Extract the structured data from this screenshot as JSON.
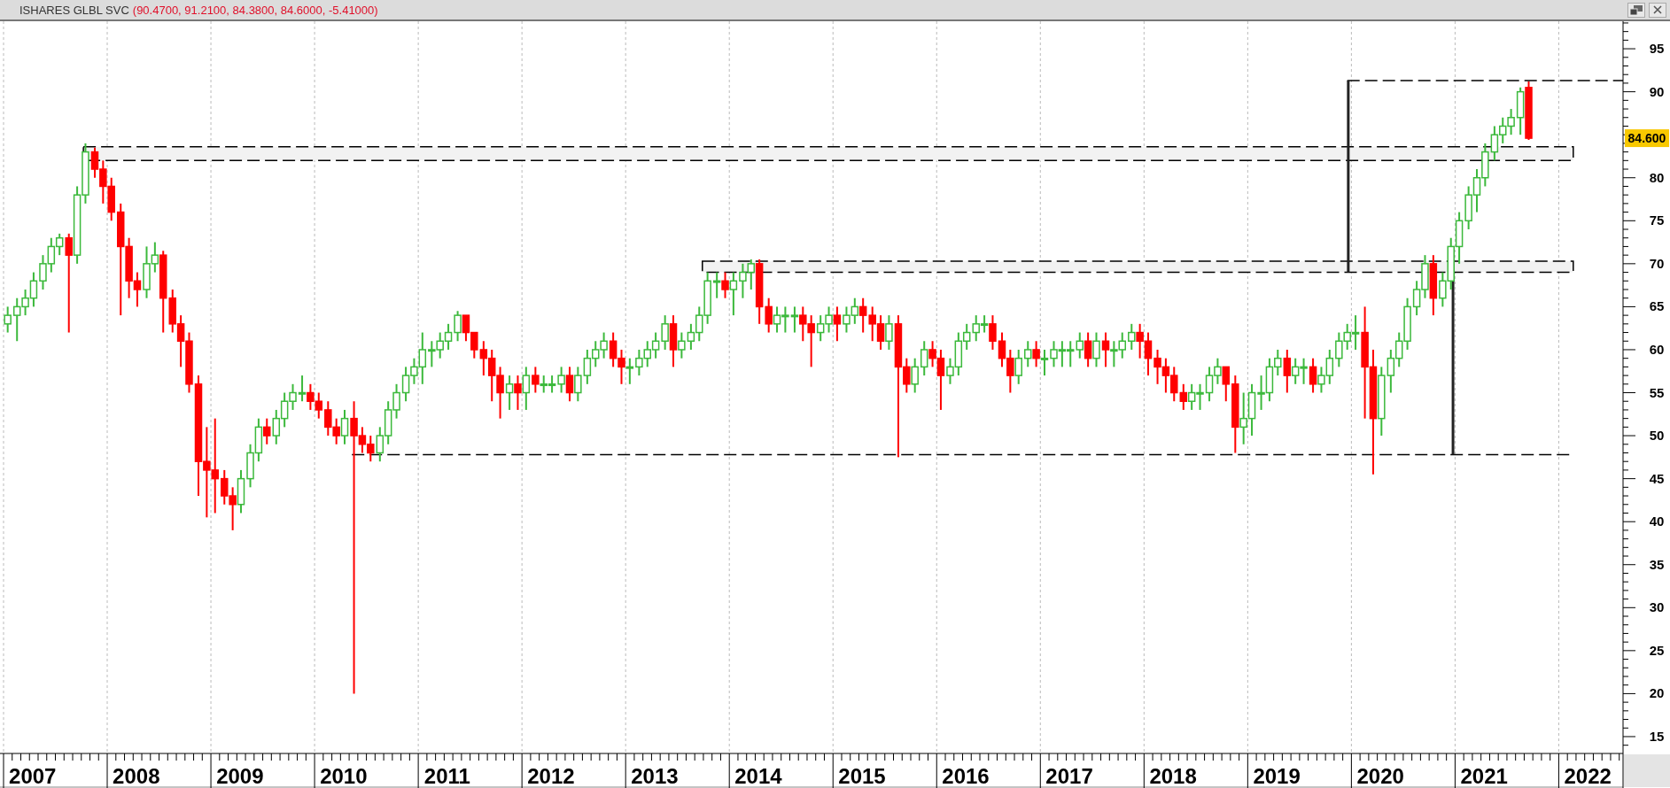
{
  "window": {
    "title": "ISHARES GLBL SVC",
    "title_values": "(90.4700, 91.2100, 84.3800, 84.6000, -5.41000)"
  },
  "chart_data": {
    "type": "candlestick",
    "xlim": [
      2007,
      2022.62
    ],
    "ylim": [
      13.04,
      98.2
    ],
    "xticks": [
      {
        "value": 2007.28,
        "label": "2007"
      },
      {
        "value": 2008.28,
        "label": "2008"
      },
      {
        "value": 2009.28,
        "label": "2009"
      },
      {
        "value": 2010.28,
        "label": "2010"
      },
      {
        "value": 2011.28,
        "label": "2011"
      },
      {
        "value": 2012.28,
        "label": "2012"
      },
      {
        "value": 2013.28,
        "label": "2013"
      },
      {
        "value": 2014.28,
        "label": "2014"
      },
      {
        "value": 2015.28,
        "label": "2015"
      },
      {
        "value": 2016.28,
        "label": "2016"
      },
      {
        "value": 2017.28,
        "label": "2017"
      },
      {
        "value": 2018.28,
        "label": "2018"
      },
      {
        "value": 2019.28,
        "label": "2019"
      },
      {
        "value": 2020.28,
        "label": "2020"
      },
      {
        "value": 2021.28,
        "label": "2021"
      },
      {
        "value": 2022.28,
        "label": "2022"
      }
    ],
    "yticks": [
      {
        "value": 15,
        "label": "15"
      },
      {
        "value": 20,
        "label": "20"
      },
      {
        "value": 25,
        "label": "25"
      },
      {
        "value": 30,
        "label": "30"
      },
      {
        "value": 35,
        "label": "35"
      },
      {
        "value": 40,
        "label": "40"
      },
      {
        "value": 45,
        "label": "45"
      },
      {
        "value": 50,
        "label": "50"
      },
      {
        "value": 55,
        "label": "55"
      },
      {
        "value": 60,
        "label": "60"
      },
      {
        "value": 65,
        "label": "65"
      },
      {
        "value": 70,
        "label": "70"
      },
      {
        "value": 75,
        "label": "75"
      },
      {
        "value": 80,
        "label": "80"
      },
      {
        "value": 90,
        "label": "90"
      },
      {
        "value": 95,
        "label": "95"
      }
    ],
    "x": [
      2007.04,
      2007.13,
      2007.21,
      2007.29,
      2007.38,
      2007.46,
      2007.54,
      2007.63,
      2007.71,
      2007.79,
      2007.88,
      2007.96,
      2008.04,
      2008.13,
      2008.21,
      2008.29,
      2008.38,
      2008.46,
      2008.54,
      2008.63,
      2008.71,
      2008.79,
      2008.88,
      2008.96,
      2009.04,
      2009.13,
      2009.21,
      2009.29,
      2009.38,
      2009.46,
      2009.54,
      2009.63,
      2009.71,
      2009.79,
      2009.88,
      2009.96,
      2010.04,
      2010.13,
      2010.21,
      2010.29,
      2010.38,
      2010.46,
      2010.54,
      2010.63,
      2010.71,
      2010.79,
      2010.88,
      2010.96,
      2011.04,
      2011.13,
      2011.21,
      2011.29,
      2011.38,
      2011.46,
      2011.54,
      2011.63,
      2011.71,
      2011.79,
      2011.88,
      2011.96,
      2012.04,
      2012.13,
      2012.21,
      2012.29,
      2012.38,
      2012.46,
      2012.54,
      2012.63,
      2012.71,
      2012.79,
      2012.88,
      2012.96,
      2013.04,
      2013.13,
      2013.21,
      2013.29,
      2013.38,
      2013.46,
      2013.54,
      2013.63,
      2013.71,
      2013.79,
      2013.88,
      2013.96,
      2014.04,
      2014.13,
      2014.21,
      2014.29,
      2014.38,
      2014.46,
      2014.54,
      2014.63,
      2014.71,
      2014.79,
      2014.88,
      2014.96,
      2015.04,
      2015.13,
      2015.21,
      2015.29,
      2015.38,
      2015.46,
      2015.54,
      2015.63,
      2015.71,
      2015.79,
      2015.88,
      2015.96,
      2016.04,
      2016.13,
      2016.21,
      2016.29,
      2016.38,
      2016.46,
      2016.54,
      2016.63,
      2016.71,
      2016.79,
      2016.88,
      2016.96,
      2017.04,
      2017.13,
      2017.21,
      2017.29,
      2017.38,
      2017.46,
      2017.54,
      2017.63,
      2017.71,
      2017.79,
      2017.88,
      2017.96,
      2018.04,
      2018.13,
      2018.21,
      2018.29,
      2018.38,
      2018.46,
      2018.54,
      2018.63,
      2018.71,
      2018.79,
      2018.88,
      2018.96,
      2019.04,
      2019.13,
      2019.21,
      2019.29,
      2019.38,
      2019.46,
      2019.54,
      2019.63,
      2019.71,
      2019.79,
      2019.88,
      2019.96,
      2020.04,
      2020.13,
      2020.21,
      2020.29,
      2020.38,
      2020.46,
      2020.54,
      2020.63,
      2020.71,
      2020.79,
      2020.88,
      2020.96,
      2021.04,
      2021.13,
      2021.21,
      2021.29,
      2021.38,
      2021.46,
      2021.54,
      2021.63,
      2021.71
    ],
    "ohlc": [
      [
        63,
        65,
        62,
        64
      ],
      [
        64,
        66,
        61,
        65
      ],
      [
        65,
        67,
        64,
        66
      ],
      [
        66,
        69,
        65,
        68
      ],
      [
        68,
        71,
        67,
        70
      ],
      [
        70,
        73,
        69,
        72
      ],
      [
        72,
        73.5,
        71,
        73
      ],
      [
        73,
        73.5,
        62,
        71
      ],
      [
        71,
        79,
        70,
        78
      ],
      [
        78,
        84,
        77,
        83
      ],
      [
        83,
        83.5,
        80,
        81
      ],
      [
        81,
        82,
        77,
        79
      ],
      [
        79,
        80,
        75,
        76
      ],
      [
        76,
        77,
        64,
        72
      ],
      [
        72,
        73,
        66,
        68
      ],
      [
        68,
        69,
        65,
        67
      ],
      [
        67,
        72,
        66,
        70
      ],
      [
        70,
        72.5,
        69,
        71
      ],
      [
        71,
        71.5,
        62,
        66
      ],
      [
        66,
        67,
        62,
        63
      ],
      [
        63,
        64,
        58,
        61
      ],
      [
        61,
        62,
        55,
        56
      ],
      [
        56,
        57,
        43,
        47
      ],
      [
        47,
        51,
        40.5,
        46
      ],
      [
        46,
        52,
        41,
        45
      ],
      [
        45,
        46,
        42,
        43
      ],
      [
        43,
        44,
        39,
        42
      ],
      [
        42,
        46,
        41,
        45
      ],
      [
        45,
        49,
        44,
        48
      ],
      [
        48,
        52,
        47,
        51
      ],
      [
        51,
        52,
        49,
        50
      ],
      [
        50,
        53,
        49,
        52
      ],
      [
        52,
        55,
        51,
        54
      ],
      [
        54,
        56,
        53,
        55
      ],
      [
        55,
        57,
        54,
        55
      ],
      [
        55,
        56,
        53,
        54
      ],
      [
        54,
        55,
        52,
        53
      ],
      [
        53,
        54,
        50,
        51
      ],
      [
        51,
        52,
        49,
        50
      ],
      [
        50,
        53,
        49,
        52
      ],
      [
        52,
        54,
        20,
        50
      ],
      [
        50,
        51,
        48,
        49
      ],
      [
        49,
        50,
        47,
        48
      ],
      [
        48,
        51,
        47,
        50
      ],
      [
        50,
        54,
        49,
        53
      ],
      [
        53,
        56,
        52,
        55
      ],
      [
        55,
        58,
        54,
        57
      ],
      [
        57,
        59,
        56,
        58
      ],
      [
        58,
        62,
        56,
        60
      ],
      [
        60,
        61,
        58,
        60
      ],
      [
        60,
        62,
        59,
        61
      ],
      [
        61,
        63,
        60,
        62
      ],
      [
        62,
        64.5,
        61,
        64
      ],
      [
        64,
        64,
        61,
        62
      ],
      [
        62,
        62,
        59,
        60
      ],
      [
        60,
        61,
        57,
        59
      ],
      [
        59,
        60,
        54,
        57
      ],
      [
        57,
        58,
        52,
        55
      ],
      [
        55,
        57,
        53,
        56
      ],
      [
        56,
        57,
        53,
        55
      ],
      [
        55,
        58,
        53,
        57
      ],
      [
        57,
        58,
        55,
        56
      ],
      [
        56,
        57,
        55,
        56
      ],
      [
        56,
        57,
        55,
        56
      ],
      [
        56,
        58,
        55,
        57
      ],
      [
        57,
        58,
        54,
        55
      ],
      [
        55,
        58,
        54,
        57
      ],
      [
        57,
        60,
        56,
        59
      ],
      [
        59,
        61,
        58,
        60
      ],
      [
        60,
        62,
        59,
        61
      ],
      [
        61,
        62,
        58,
        59
      ],
      [
        59,
        60,
        56,
        58
      ],
      [
        58,
        59,
        56,
        58
      ],
      [
        58,
        60,
        57,
        59
      ],
      [
        59,
        61,
        58,
        60
      ],
      [
        60,
        62,
        59,
        61
      ],
      [
        61,
        64,
        60,
        63
      ],
      [
        63,
        64,
        58,
        60
      ],
      [
        60,
        62,
        59,
        61
      ],
      [
        61,
        63,
        60,
        62
      ],
      [
        62,
        65,
        61,
        64
      ],
      [
        64,
        69,
        63,
        68
      ],
      [
        68,
        69,
        66,
        68
      ],
      [
        68,
        69,
        66,
        67
      ],
      [
        67,
        69,
        64,
        68
      ],
      [
        68,
        70,
        66,
        69
      ],
      [
        69,
        70.5,
        67,
        70
      ],
      [
        70,
        70.5,
        63,
        65
      ],
      [
        65,
        66,
        62,
        63
      ],
      [
        63,
        65,
        62,
        64
      ],
      [
        64,
        65,
        62,
        64
      ],
      [
        64,
        65,
        62,
        64
      ],
      [
        64,
        65,
        61,
        63
      ],
      [
        63,
        64,
        58,
        62
      ],
      [
        62,
        64,
        61,
        63
      ],
      [
        63,
        65,
        62,
        64
      ],
      [
        64,
        65,
        61,
        63
      ],
      [
        63,
        65,
        62,
        64
      ],
      [
        64,
        66,
        63,
        65
      ],
      [
        65,
        66,
        62,
        64
      ],
      [
        64,
        65,
        61,
        63
      ],
      [
        63,
        64,
        60,
        61
      ],
      [
        61,
        64,
        60,
        63
      ],
      [
        63,
        64,
        47.5,
        58
      ],
      [
        58,
        59,
        55,
        56
      ],
      [
        56,
        59,
        55,
        58
      ],
      [
        58,
        61,
        57,
        60
      ],
      [
        60,
        61,
        58,
        59
      ],
      [
        59,
        60,
        53,
        57
      ],
      [
        57,
        59,
        56,
        58
      ],
      [
        58,
        62,
        57,
        61
      ],
      [
        61,
        63,
        60,
        62
      ],
      [
        62,
        64,
        61,
        63
      ],
      [
        63,
        64,
        62,
        63
      ],
      [
        63,
        64,
        60,
        61
      ],
      [
        61,
        62,
        58,
        59
      ],
      [
        59,
        60,
        55,
        57
      ],
      [
        57,
        60,
        56,
        59
      ],
      [
        59,
        61,
        58,
        60
      ],
      [
        60,
        61,
        58,
        59
      ],
      [
        59,
        60,
        57,
        59
      ],
      [
        59,
        61,
        58,
        60
      ],
      [
        60,
        61,
        58,
        60
      ],
      [
        60,
        61,
        58,
        60
      ],
      [
        60,
        62,
        59,
        61
      ],
      [
        61,
        62,
        58,
        59
      ],
      [
        59,
        62,
        58,
        61
      ],
      [
        61,
        62,
        58,
        60
      ],
      [
        60,
        61,
        58,
        60
      ],
      [
        60,
        62,
        59,
        61
      ],
      [
        61,
        63,
        60,
        62
      ],
      [
        62,
        63,
        59,
        61
      ],
      [
        61,
        62,
        57,
        59
      ],
      [
        59,
        60,
        56,
        58
      ],
      [
        58,
        59,
        55,
        57
      ],
      [
        57,
        58,
        54,
        55
      ],
      [
        55,
        56,
        53,
        54
      ],
      [
        54,
        56,
        53,
        55
      ],
      [
        55,
        56,
        53,
        55
      ],
      [
        55,
        58,
        54,
        57
      ],
      [
        57,
        59,
        56,
        58
      ],
      [
        58,
        58,
        54,
        56
      ],
      [
        56,
        57,
        48,
        51
      ],
      [
        51,
        55,
        49,
        52
      ],
      [
        52,
        56,
        50,
        55
      ],
      [
        55,
        57,
        53,
        55
      ],
      [
        55,
        59,
        54,
        58
      ],
      [
        58,
        60,
        57,
        59
      ],
      [
        59,
        60,
        55,
        57
      ],
      [
        57,
        59,
        56,
        58
      ],
      [
        58,
        59,
        56,
        58
      ],
      [
        58,
        59,
        55,
        56
      ],
      [
        56,
        58,
        55,
        57
      ],
      [
        57,
        60,
        56,
        59
      ],
      [
        59,
        62,
        58,
        61
      ],
      [
        61,
        63,
        60,
        62
      ],
      [
        62,
        64,
        60,
        62
      ],
      [
        62,
        65,
        52,
        58
      ],
      [
        58,
        60,
        45.5,
        52
      ],
      [
        52,
        58,
        50,
        57
      ],
      [
        57,
        60,
        55,
        59
      ],
      [
        59,
        62,
        58,
        61
      ],
      [
        61,
        66,
        60,
        65
      ],
      [
        65,
        68,
        64,
        67
      ],
      [
        67,
        71,
        66,
        70
      ],
      [
        70,
        71,
        64,
        66
      ],
      [
        66,
        69,
        65,
        68
      ],
      [
        68,
        73,
        67,
        72
      ],
      [
        72,
        76,
        70,
        75
      ],
      [
        75,
        79,
        74,
        78
      ],
      [
        78,
        81,
        76,
        80
      ],
      [
        80,
        84,
        79,
        83
      ],
      [
        83,
        86,
        82,
        85
      ],
      [
        85,
        87,
        84,
        86
      ],
      [
        86,
        88,
        85,
        87
      ],
      [
        87,
        90.5,
        85,
        90
      ],
      [
        90.5,
        91.2,
        84.4,
        84.6
      ]
    ],
    "bands": [
      {
        "axis": "y",
        "from": 82,
        "to": 83.6
      },
      {
        "axis": "y",
        "from": 69,
        "to": 70.3
      }
    ],
    "ref_lines": [
      {
        "axis": "y",
        "value": 47.8
      },
      {
        "axis": "y",
        "value": 91.3
      },
      {
        "axis": "x",
        "value": 2019.97
      },
      {
        "axis": "x",
        "value": 2020.98
      }
    ]
  },
  "price_tag": {
    "label": "84.600"
  }
}
